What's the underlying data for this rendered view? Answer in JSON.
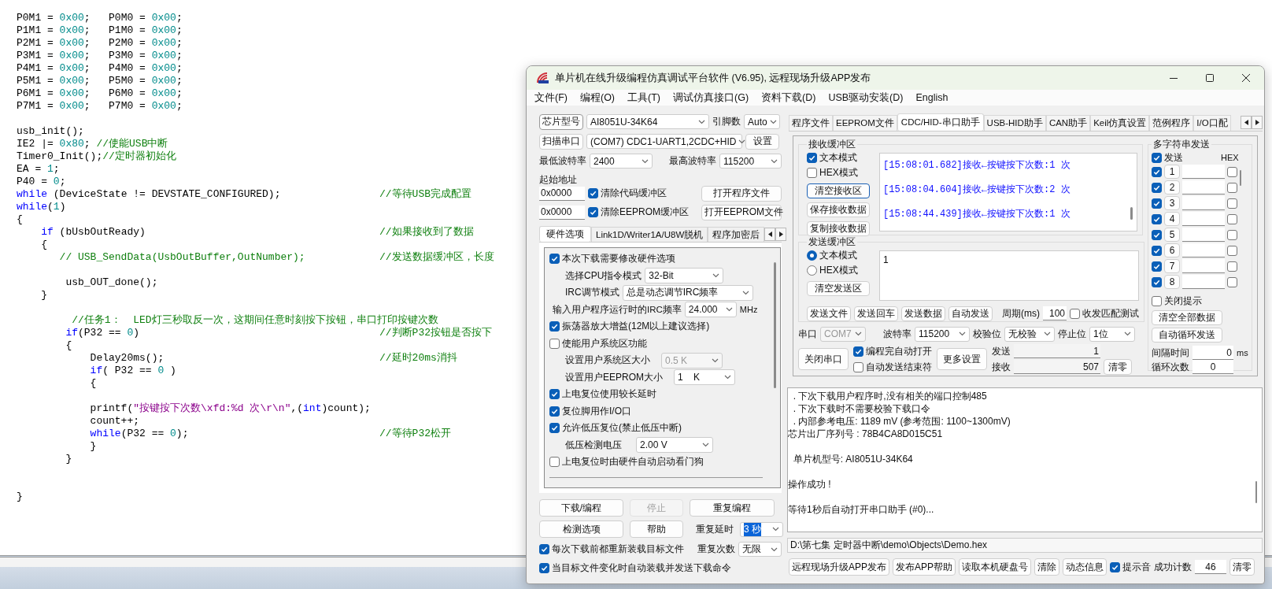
{
  "editor": {
    "lines": [
      {
        "kind": "code",
        "tokens": [
          {
            "kind": "plain",
            "text": "P0M1 = "
          },
          {
            "kind": "num",
            "text": "0x00"
          },
          {
            "kind": "plain",
            "text": ";   P0M0 = "
          },
          {
            "kind": "num",
            "text": "0x00"
          },
          {
            "kind": "plain",
            "text": ";"
          }
        ]
      },
      {
        "kind": "code",
        "tokens": [
          {
            "kind": "plain",
            "text": "P1M1 = "
          },
          {
            "kind": "num",
            "text": "0x00"
          },
          {
            "kind": "plain",
            "text": ";   P1M0 = "
          },
          {
            "kind": "num",
            "text": "0x00"
          },
          {
            "kind": "plain",
            "text": ";"
          }
        ]
      },
      {
        "kind": "code",
        "tokens": [
          {
            "kind": "plain",
            "text": "P2M1 = "
          },
          {
            "kind": "num",
            "text": "0x00"
          },
          {
            "kind": "plain",
            "text": ";   P2M0 = "
          },
          {
            "kind": "num",
            "text": "0x00"
          },
          {
            "kind": "plain",
            "text": ";"
          }
        ]
      },
      {
        "kind": "code",
        "tokens": [
          {
            "kind": "plain",
            "text": "P3M1 = "
          },
          {
            "kind": "num",
            "text": "0x00"
          },
          {
            "kind": "plain",
            "text": ";   P3M0 = "
          },
          {
            "kind": "num",
            "text": "0x00"
          },
          {
            "kind": "plain",
            "text": ";"
          }
        ]
      },
      {
        "kind": "code",
        "tokens": [
          {
            "kind": "plain",
            "text": "P4M1 = "
          },
          {
            "kind": "num",
            "text": "0x00"
          },
          {
            "kind": "plain",
            "text": ";   P4M0 = "
          },
          {
            "kind": "num",
            "text": "0x00"
          },
          {
            "kind": "plain",
            "text": ";"
          }
        ]
      },
      {
        "kind": "code",
        "tokens": [
          {
            "kind": "plain",
            "text": "P5M1 = "
          },
          {
            "kind": "num",
            "text": "0x00"
          },
          {
            "kind": "plain",
            "text": ";   P5M0 = "
          },
          {
            "kind": "num",
            "text": "0x00"
          },
          {
            "kind": "plain",
            "text": ";"
          }
        ]
      },
      {
        "kind": "code",
        "tokens": [
          {
            "kind": "plain",
            "text": "P6M1 = "
          },
          {
            "kind": "num",
            "text": "0x00"
          },
          {
            "kind": "plain",
            "text": ";   P6M0 = "
          },
          {
            "kind": "num",
            "text": "0x00"
          },
          {
            "kind": "plain",
            "text": ";"
          }
        ]
      },
      {
        "kind": "code",
        "tokens": [
          {
            "kind": "plain",
            "text": "P7M1 = "
          },
          {
            "kind": "num",
            "text": "0x00"
          },
          {
            "kind": "plain",
            "text": ";   P7M0 = "
          },
          {
            "kind": "num",
            "text": "0x00"
          },
          {
            "kind": "plain",
            "text": ";"
          }
        ]
      },
      {
        "kind": "blank"
      },
      {
        "kind": "code",
        "tokens": [
          {
            "kind": "plain",
            "text": "usb_init();"
          }
        ]
      },
      {
        "kind": "code",
        "tokens": [
          {
            "kind": "plain",
            "text": "IE2 |= "
          },
          {
            "kind": "num",
            "text": "0x80"
          },
          {
            "kind": "plain",
            "text": "; "
          },
          {
            "kind": "comment",
            "text": "//使能USB中断"
          }
        ]
      },
      {
        "kind": "code",
        "tokens": [
          {
            "kind": "plain",
            "text": "Timer0_Init();"
          },
          {
            "kind": "comment",
            "text": "//定时器初始化"
          }
        ]
      },
      {
        "kind": "code",
        "tokens": [
          {
            "kind": "plain",
            "text": "EA = "
          },
          {
            "kind": "num",
            "text": "1"
          },
          {
            "kind": "plain",
            "text": ";"
          }
        ]
      },
      {
        "kind": "code",
        "tokens": [
          {
            "kind": "plain",
            "text": "P40 = "
          },
          {
            "kind": "num",
            "text": "0"
          },
          {
            "kind": "plain",
            "text": ";"
          }
        ]
      },
      {
        "kind": "code",
        "tokens": [
          {
            "kind": "kw",
            "text": "while"
          },
          {
            "kind": "plain",
            "text": " (DeviceState != DEVSTATE_CONFIGURED);"
          }
        ],
        "note": "//等待USB完成配置"
      },
      {
        "kind": "code",
        "tokens": [
          {
            "kind": "kw",
            "text": "while"
          },
          {
            "kind": "plain",
            "text": "("
          },
          {
            "kind": "num",
            "text": "1"
          },
          {
            "kind": "plain",
            "text": ")"
          }
        ]
      },
      {
        "kind": "code",
        "tokens": [
          {
            "kind": "plain",
            "text": "{"
          }
        ]
      },
      {
        "kind": "code",
        "tokens": [
          {
            "kind": "kw",
            "text": "    if"
          },
          {
            "kind": "plain",
            "text": " (bUsbOutReady)"
          }
        ],
        "note": "//如果接收到了数据"
      },
      {
        "kind": "code",
        "tokens": [
          {
            "kind": "plain",
            "text": "    {"
          }
        ]
      },
      {
        "kind": "code",
        "tokens": [
          {
            "kind": "comment",
            "text": "       // USB_SendData(UsbOutBuffer,OutNumber);"
          }
        ],
        "note": "//发送数据缓冲区，长度"
      },
      {
        "kind": "blank"
      },
      {
        "kind": "code",
        "tokens": [
          {
            "kind": "plain",
            "text": "        usb_OUT_done();"
          }
        ]
      },
      {
        "kind": "code",
        "tokens": [
          {
            "kind": "plain",
            "text": "    }"
          }
        ]
      },
      {
        "kind": "blank"
      },
      {
        "kind": "code",
        "tokens": [
          {
            "kind": "comment",
            "text": "         //任务1：  LED灯三秒取反一次，这期间任意时刻按下按钮，串口打印按键次数"
          }
        ]
      },
      {
        "kind": "code",
        "tokens": [
          {
            "kind": "kw",
            "text": "        if"
          },
          {
            "kind": "plain",
            "text": "(P32 == "
          },
          {
            "kind": "num",
            "text": "0"
          },
          {
            "kind": "plain",
            "text": ")"
          }
        ],
        "note": "//判断P32按钮是否按下"
      },
      {
        "kind": "code",
        "tokens": [
          {
            "kind": "plain",
            "text": "        {"
          }
        ]
      },
      {
        "kind": "code",
        "tokens": [
          {
            "kind": "plain",
            "text": "            Delay20ms();"
          }
        ],
        "note": "//延时20ms消抖"
      },
      {
        "kind": "code",
        "tokens": [
          {
            "kind": "kw",
            "text": "            if"
          },
          {
            "kind": "plain",
            "text": "( P32 == "
          },
          {
            "kind": "num",
            "text": "0"
          },
          {
            "kind": "plain",
            "text": " )"
          }
        ]
      },
      {
        "kind": "code",
        "tokens": [
          {
            "kind": "plain",
            "text": "            {"
          }
        ]
      },
      {
        "kind": "blank"
      },
      {
        "kind": "code",
        "tokens": [
          {
            "kind": "plain",
            "text": "            printf("
          },
          {
            "kind": "str",
            "text": "\"按键按下次数\\xfd:%d 次\\r\\n\""
          },
          {
            "kind": "plain",
            "text": ",("
          },
          {
            "kind": "kw",
            "text": "int"
          },
          {
            "kind": "plain",
            "text": ")count);"
          }
        ]
      },
      {
        "kind": "code",
        "tokens": [
          {
            "kind": "plain",
            "text": "            count++;"
          }
        ]
      },
      {
        "kind": "code",
        "tokens": [
          {
            "kind": "kw",
            "text": "            while"
          },
          {
            "kind": "plain",
            "text": "(P32 == "
          },
          {
            "kind": "num",
            "text": "0"
          },
          {
            "kind": "plain",
            "text": ");"
          }
        ],
        "note": "//等待P32松开"
      },
      {
        "kind": "code",
        "tokens": [
          {
            "kind": "plain",
            "text": "            }"
          }
        ]
      },
      {
        "kind": "code",
        "tokens": [
          {
            "kind": "plain",
            "text": "        }"
          }
        ]
      },
      {
        "kind": "blank"
      },
      {
        "kind": "blank"
      },
      {
        "kind": "code",
        "tokens": [
          {
            "kind": "plain",
            "text": "}"
          }
        ]
      }
    ]
  },
  "window": {
    "title": "单片机在线升级编程仿真调试平台软件 (V6.95), 远程现场升级APP发布",
    "menu": [
      "文件(F)",
      "编程(O)",
      "工具(T)",
      "调试仿真接口(G)",
      "资料下载(D)",
      "USB驱动安装(D)",
      "English"
    ],
    "chip": {
      "button": "芯片型号",
      "value": "AI8051U-34K64",
      "pins_label": "引脚数",
      "pins": "Auto"
    },
    "port": {
      "button": "扫描串口",
      "value": "(COM7) CDC1-UART1,2CDC+HID",
      "settings": "设置"
    },
    "baud": {
      "min_label": "最低波特率",
      "min": "2400",
      "max_label": "最高波特率",
      "max": "115200"
    },
    "address": {
      "label": "起始地址",
      "rows": [
        {
          "value": "0x0000",
          "check_label": "清除代码缓冲区",
          "checked": true,
          "button": "打开程序文件"
        },
        {
          "value": "0x0000",
          "check_label": "清除EEPROM缓冲区",
          "checked": true,
          "button": "打开EEPROM文件"
        }
      ]
    },
    "left_tabs": [
      {
        "label": "硬件选项",
        "selected": true
      },
      {
        "label": "Link1D/Writer1A/U8W脱机",
        "selected": false
      },
      {
        "label": "程序加密后",
        "selected": false
      }
    ],
    "hardware_options": [
      {
        "kind": "checkbox",
        "label": "本次下载需要修改硬件选项",
        "checked": true
      },
      {
        "kind": "select",
        "label": "选择CPU指令模式",
        "value": "32-Bit",
        "disabled": false
      },
      {
        "kind": "select",
        "label": "IRC调节模式",
        "value": "总是动态调节IRC频率",
        "disabled": false
      },
      {
        "kind": "select",
        "label": "输入用户程序运行时的IRC频率",
        "value": "24.000",
        "unit": "MHz",
        "disabled": false
      },
      {
        "kind": "checkbox",
        "label": "振荡器放大增益(12M以上建议选择)",
        "checked": true
      },
      {
        "kind": "checkbox",
        "label": "使能用户系统区功能",
        "checked": false
      },
      {
        "kind": "select",
        "label": "设置用户系统区大小",
        "value": "0.5 K",
        "disabled": true
      },
      {
        "kind": "select",
        "label": "设置用户EEPROM大小",
        "value": "1    K",
        "disabled": false
      },
      {
        "kind": "checkbox",
        "label": "上电复位使用较长延时",
        "checked": true
      },
      {
        "kind": "checkbox",
        "label": "复位脚用作I/O口",
        "checked": true
      },
      {
        "kind": "checkbox",
        "label": "允许低压复位(禁止低压中断)",
        "checked": true
      },
      {
        "kind": "select",
        "label": "低压检测电压",
        "value": "2.00 V",
        "disabled": false
      },
      {
        "kind": "checkbox",
        "label": "上电复位时由硬件自动启动看门狗",
        "checked": false
      }
    ],
    "actions": [
      {
        "label": "下载/编程",
        "disabled": false
      },
      {
        "label": "停止",
        "disabled": true
      },
      {
        "label": "重复编程",
        "disabled": false
      },
      {
        "label": "检测选项",
        "disabled": false
      },
      {
        "label": "帮助",
        "disabled": false
      }
    ],
    "repeat": {
      "delay_label": "重复延时",
      "delay": "3 秒",
      "delay_highlighted": true,
      "count_label": "重复次数",
      "count": "无限"
    },
    "load_options": [
      {
        "label": "每次下载前都重新装载目标文件",
        "checked": true
      },
      {
        "label": "当目标文件变化时自动装载并发送下载命令",
        "checked": true
      }
    ],
    "right_tabs": [
      {
        "label": "程序文件",
        "selected": false
      },
      {
        "label": "EEPROM文件",
        "selected": false
      },
      {
        "label": "CDC/HID-串口助手",
        "selected": true
      },
      {
        "label": "USB-HID助手",
        "selected": false
      },
      {
        "label": "CAN助手",
        "selected": false
      },
      {
        "label": "Keil仿真设置",
        "selected": false
      },
      {
        "label": "范例程序",
        "selected": false
      },
      {
        "label": "I/O口配",
        "selected": false
      }
    ],
    "receive": {
      "title": "接收缓冲区",
      "modes": [
        {
          "label": "文本模式",
          "checked": true
        },
        {
          "label": "HEX模式",
          "checked": false
        }
      ],
      "buttons": [
        {
          "label": "清空接收区",
          "focused": true
        },
        {
          "label": "保存接收数据",
          "focused": false
        },
        {
          "label": "复制接收数据",
          "focused": false
        }
      ],
      "lines": [
        "[15:08:01.682]接收←按键按下次数:1 次",
        "[15:08:04.604]接收←按键按下次数:2 次",
        "[15:08:44.439]接收←按键按下次数:1 次"
      ]
    },
    "send": {
      "title": "发送缓冲区",
      "modes": [
        {
          "label": "文本模式",
          "selected": true
        },
        {
          "label": "HEX模式",
          "selected": false
        }
      ],
      "clear": "清空发送区",
      "text": "1",
      "buttons": [
        "发送文件",
        "发送回车",
        "发送数据",
        "自动发送"
      ],
      "period_label": "周期(ms)",
      "period": "100",
      "match": {
        "label": "收发匹配测试",
        "checked": false
      }
    },
    "serial": {
      "port_label": "串口",
      "port": "COM7",
      "port_disabled": true,
      "baud_label": "波特率",
      "baud": "115200",
      "parity_label": "校验位",
      "parity": "无校验",
      "stop_label": "停止位",
      "stop": "1位"
    },
    "serial_actions": {
      "close": "关闭串口",
      "options": [
        {
          "label": "编程完自动打开",
          "checked": true
        },
        {
          "label": "自动发送结束符",
          "checked": false
        }
      ],
      "more": "更多设置",
      "sent_label": "发送",
      "sent": "1",
      "received_label": "接收",
      "received": "507",
      "reset": "清零"
    },
    "multi_send": {
      "title": "多字符串发送",
      "header": {
        "label": "发送",
        "checked": true
      },
      "hex_label": "HEX",
      "rows": [
        {
          "number": "1",
          "checked": true,
          "hex": false
        },
        {
          "number": "2",
          "checked": true,
          "hex": false
        },
        {
          "number": "3",
          "checked": true,
          "hex": false
        },
        {
          "number": "4",
          "checked": true,
          "hex": false
        },
        {
          "number": "5",
          "checked": true,
          "hex": false
        },
        {
          "number": "6",
          "checked": true,
          "hex": false
        },
        {
          "number": "7",
          "checked": true,
          "hex": false
        },
        {
          "number": "8",
          "checked": true,
          "hex": false
        }
      ],
      "close_tip": {
        "label": "关闭提示",
        "checked": false
      },
      "clear_all": "清空全部数据",
      "auto_loop": "自动循环发送",
      "interval_label": "间隔时间",
      "interval": "0",
      "interval_unit": "ms",
      "loops_label": "循环次数",
      "loops": "0"
    },
    "log": [
      {
        "kind": "text",
        "text": "  . 下次下载用户程序时,没有相关的端口控制485"
      },
      {
        "kind": "text",
        "text": "  . 下次下载时不需要校验下载口令"
      },
      {
        "kind": "text",
        "text": "  . 内部参考电压: 1189 mV (参考范围: 1100~1300mV)"
      },
      {
        "kind": "text",
        "text": "芯片出厂序列号 : 78B4CA8D015C51"
      },
      {
        "kind": "blank"
      },
      {
        "kind": "text",
        "text": "  单片机型号: AI8051U-34K64"
      },
      {
        "kind": "blank"
      },
      {
        "kind": "text",
        "text": "操作成功 !"
      },
      {
        "kind": "blank"
      },
      {
        "kind": "text",
        "text": "等待1秒后自动打开串口助手 (#0)..."
      }
    ],
    "hex_path": "D:\\第七集 定时器中断\\demo\\Objects\\Demo.hex",
    "footer": {
      "buttons": [
        "远程现场升级APP发布",
        "发布APP帮助",
        "读取本机硬盘号",
        "清除",
        "动态信息"
      ],
      "sound": {
        "label": "提示音",
        "checked": true
      },
      "count_label": "成功计数",
      "count": "46",
      "reset": "清零"
    }
  }
}
